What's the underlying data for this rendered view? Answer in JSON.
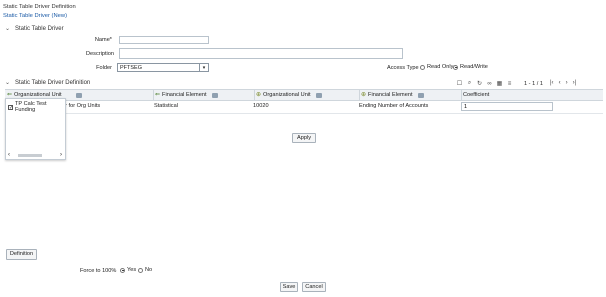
{
  "header": {
    "title": "Static Table Driver Definition",
    "subtitle": "Static Table Driver (New)"
  },
  "form": {
    "section_title": "Static Table Driver",
    "name_label": "Name*",
    "name_value": "",
    "description_label": "Description",
    "description_value": "",
    "folder_label": "Folder",
    "folder_value": "PFTSEG",
    "access_type_label": "Access Type",
    "access_options": [
      "Read Only",
      "Read/Write"
    ],
    "access_selected": "Read/Write"
  },
  "driver_section": {
    "title": "Static Table Driver Definition",
    "pagination": "1 - 1 / 1",
    "columns": [
      "Organizational Unit",
      "Financial Element",
      "Organizational Unit",
      "Financial Element",
      "Coefficient"
    ],
    "rows": [
      {
        "org_unit": "er for Org Units",
        "fin_element": "Statistical",
        "org_unit2": "10020",
        "fin_element2": "Ending Number of Accounts",
        "coefficient": "1"
      }
    ],
    "dropdown_item": "TP Calc Test Funding"
  },
  "buttons": {
    "apply": "Apply",
    "definition": "Definition",
    "save": "Save",
    "cancel": "Cancel"
  },
  "footer": {
    "force_label": "Force to 100%",
    "options": [
      "Yes",
      "No"
    ],
    "selected": "Yes"
  }
}
